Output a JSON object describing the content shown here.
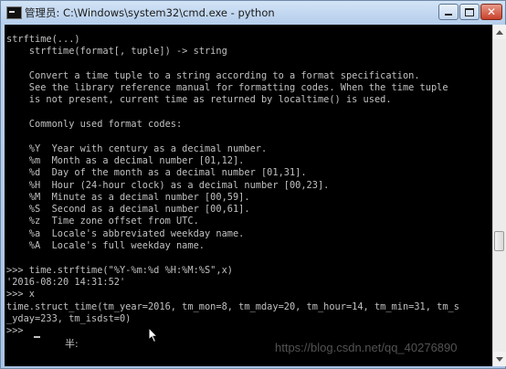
{
  "window": {
    "title": "管理员: C:\\Windows\\system32\\cmd.exe - python",
    "icon": "console-icon",
    "close_glyph": "✕"
  },
  "console": {
    "lines": [
      "strftime(...)",
      "    strftime(format[, tuple]) -> string",
      "",
      "    Convert a time tuple to a string according to a format specification.",
      "    See the library reference manual for formatting codes. When the time tuple",
      "    is not present, current time as returned by localtime() is used.",
      "",
      "    Commonly used format codes:",
      "",
      "    %Y  Year with century as a decimal number.",
      "    %m  Month as a decimal number [01,12].",
      "    %d  Day of the month as a decimal number [01,31].",
      "    %H  Hour (24-hour clock) as a decimal number [00,23].",
      "    %M  Minute as a decimal number [00,59].",
      "    %S  Second as a decimal number [00,61].",
      "    %z  Time zone offset from UTC.",
      "    %a  Locale's abbreviated weekday name.",
      "    %A  Locale's full weekday name.",
      "",
      ">>> time.strftime(\"%Y-%m:%d %H:%M:%S\",x)",
      "'2016-08:20 14:31:52'",
      ">>> x",
      "time.struct_time(tm_year=2016, tm_mon=8, tm_mday=20, tm_hour=14, tm_min=31, tm_s",
      "_yday=233, tm_isdst=0)",
      ">>>"
    ],
    "ime_indicator": "半:",
    "watermark": "https://blog.csdn.net/qq_40276890"
  },
  "colors": {
    "console_bg": "#000000",
    "console_fg": "#c0c0c0",
    "titlebar": "#b4cdeb"
  }
}
